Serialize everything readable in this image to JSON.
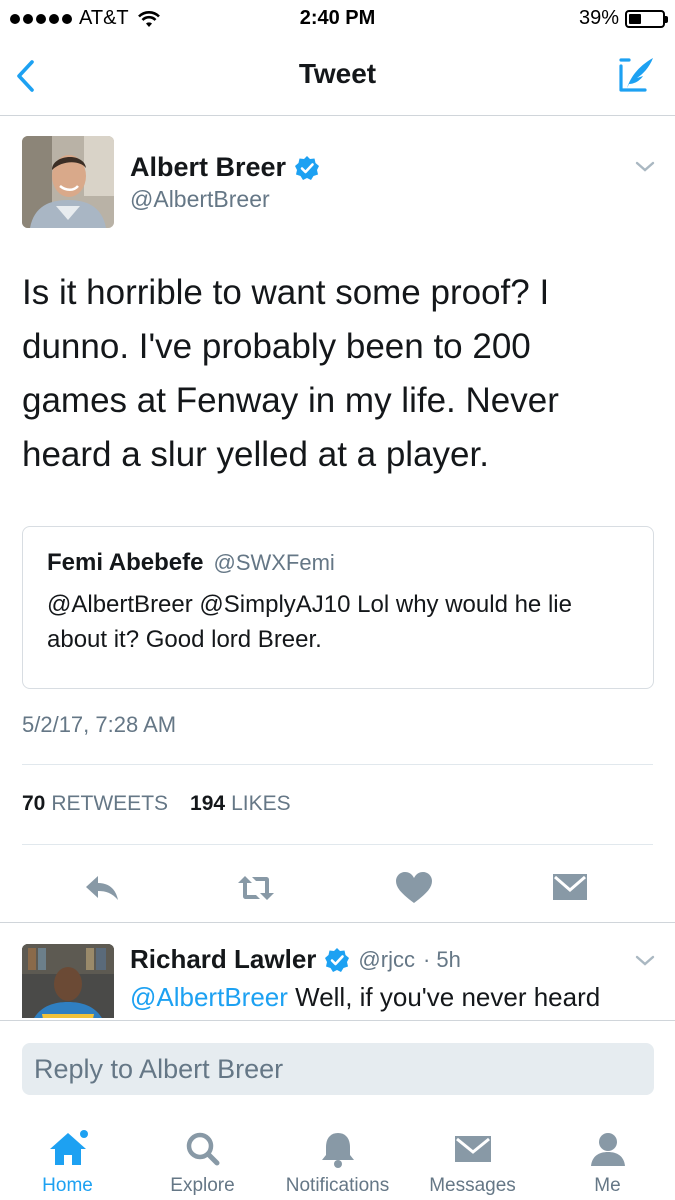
{
  "status_bar": {
    "carrier": "AT&T",
    "time": "2:40 PM",
    "battery": "39%",
    "battery_level": 0.39
  },
  "nav": {
    "title": "Tweet",
    "back_icon": "chevron-left-icon",
    "compose_icon": "compose-icon"
  },
  "tweet": {
    "author_name": "Albert Breer",
    "author_handle": "@AlbertBreer",
    "verified": true,
    "text": "Is it horrible to want some proof? I dunno. I've probably been to 200 games at Fenway in my life. Never heard a slur yelled at a player.",
    "quote": {
      "name": "Femi Abebefe",
      "handle": "@SWXFemi",
      "text": "@AlbertBreer @SimplyAJ10 Lol why would he lie about it? Good lord Breer."
    },
    "timestamp": "5/2/17, 7:28 AM",
    "retweets_count": "70",
    "retweets_label": "RETWEETS",
    "likes_count": "194",
    "likes_label": "LIKES"
  },
  "reply": {
    "name": "Richard Lawler",
    "handle": "@rjcc",
    "age": "· 5h",
    "mention": "@AlbertBreer",
    "text": " Well, if you've never heard something that means it didn't happen"
  },
  "reply_box": {
    "placeholder": "Reply to Albert Breer"
  },
  "tabs": [
    {
      "label": "Home",
      "icon": "home-icon",
      "active": true
    },
    {
      "label": "Explore",
      "icon": "search-icon",
      "active": false
    },
    {
      "label": "Notifications",
      "icon": "bell-icon",
      "active": false
    },
    {
      "label": "Messages",
      "icon": "envelope-icon",
      "active": false
    },
    {
      "label": "Me",
      "icon": "person-icon",
      "active": false
    }
  ],
  "colors": {
    "accent": "#1da1f2",
    "secondary_text": "#657786",
    "icon_gray": "#8899a6"
  }
}
